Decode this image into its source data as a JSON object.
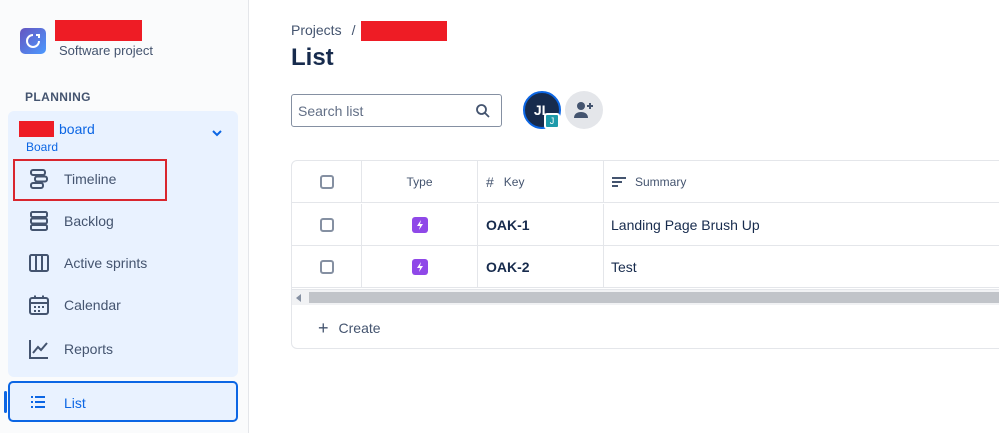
{
  "sidebar": {
    "project_subtitle": "Software project",
    "section_label": "PLANNING",
    "board": {
      "title_suffix": "board",
      "subtitle": "Board"
    },
    "nav_items": [
      {
        "label": "Timeline",
        "icon": "timeline-icon"
      },
      {
        "label": "Backlog",
        "icon": "backlog-icon"
      },
      {
        "label": "Active sprints",
        "icon": "columns-icon"
      },
      {
        "label": "Calendar",
        "icon": "calendar-icon"
      },
      {
        "label": "Reports",
        "icon": "chart-line-icon"
      }
    ],
    "list_item": {
      "label": "List",
      "icon": "list-icon"
    }
  },
  "main": {
    "breadcrumb": {
      "root": "Projects",
      "separator": "/"
    },
    "title": "List",
    "search": {
      "placeholder": "Search list"
    },
    "avatar": {
      "initials": "JL",
      "badge": "J"
    },
    "table": {
      "headers": {
        "type": "Type",
        "key": "Key",
        "summary": "Summary"
      },
      "rows": [
        {
          "key": "OAK-1",
          "summary": "Landing Page Brush Up"
        },
        {
          "key": "OAK-2",
          "summary": "Test"
        }
      ]
    },
    "create_label": "Create"
  },
  "colors": {
    "accent": "#0c66e4",
    "redaction": "#ee1c25",
    "issue_type": "#8f48e8",
    "highlight_box": "#d9262e"
  }
}
